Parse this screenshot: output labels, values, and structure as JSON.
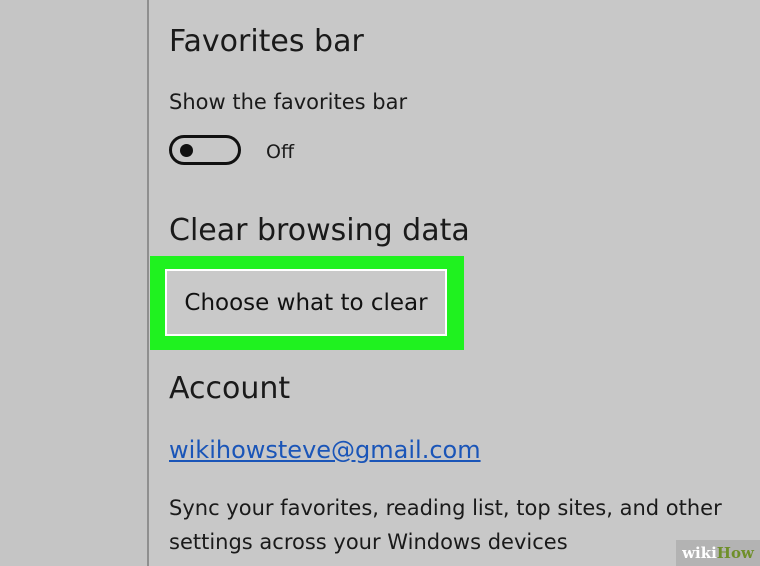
{
  "favorites": {
    "heading": "Favorites bar",
    "show_label": "Show the favorites bar",
    "toggle_state": "Off"
  },
  "clear_data": {
    "heading": "Clear browsing data",
    "button_label": "Choose what to clear"
  },
  "account": {
    "heading": "Account",
    "email": "wikihowsteve@gmail.com",
    "sync_description": "Sync your favorites, reading list, top sites, and other settings across your Windows devices"
  },
  "watermark": {
    "part1": "wiki",
    "part2": "How"
  },
  "colors": {
    "highlight": "#1ff21f",
    "link": "#1a55b8"
  }
}
